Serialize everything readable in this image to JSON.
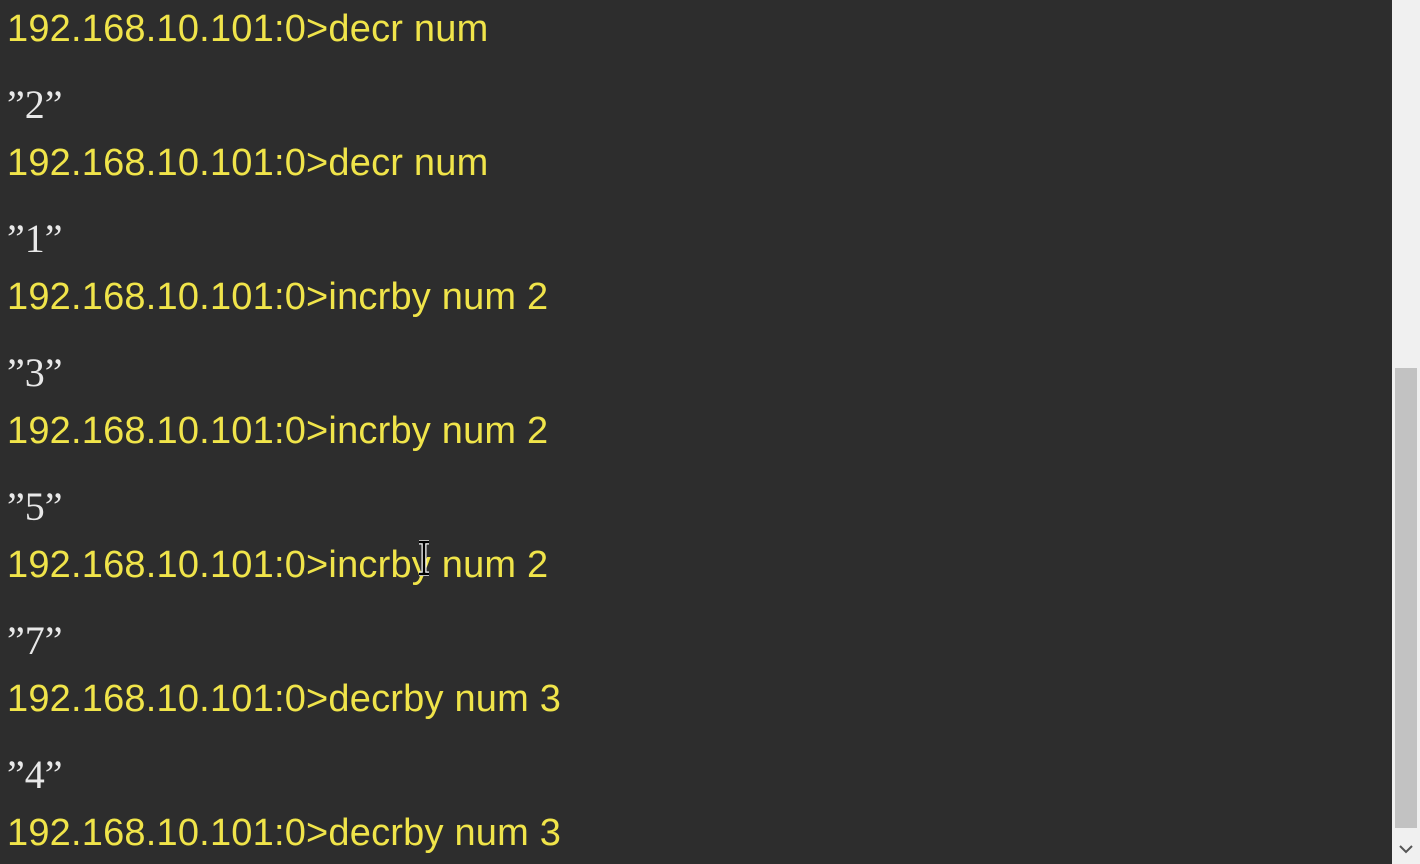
{
  "console": {
    "lines": [
      {
        "type": "command",
        "text": "192.168.10.101:0>decr num"
      },
      {
        "type": "output",
        "text": "”2”"
      },
      {
        "type": "command",
        "text": "192.168.10.101:0>decr num"
      },
      {
        "type": "output",
        "text": "”1”"
      },
      {
        "type": "command",
        "text": "192.168.10.101:0>incrby num 2"
      },
      {
        "type": "output",
        "text": "”3”"
      },
      {
        "type": "command",
        "text": "192.168.10.101:0>incrby num 2"
      },
      {
        "type": "output",
        "text": "”5”"
      },
      {
        "type": "command",
        "text": "192.168.10.101:0>incrby num 2"
      },
      {
        "type": "output",
        "text": "”7”"
      },
      {
        "type": "command",
        "text": "192.168.10.101:0>decrby num 3"
      },
      {
        "type": "output",
        "text": "”4”"
      },
      {
        "type": "command",
        "text": "192.168.10.101:0>decrby num 3"
      }
    ]
  },
  "colors": {
    "background": "#2d2d2d",
    "command_text": "#f0e44a",
    "output_text": "#e8e8e8"
  },
  "icons": {
    "cursor": "ibeam-cursor-icon",
    "scroll_down": "chevron-down-icon"
  }
}
